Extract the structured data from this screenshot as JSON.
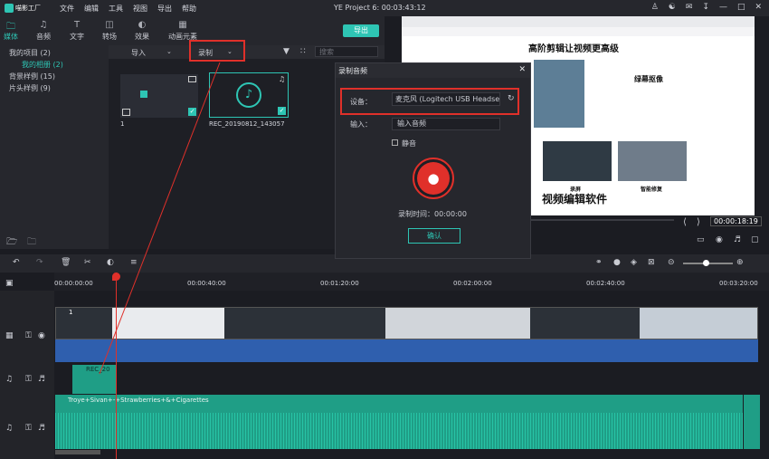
{
  "app": {
    "name": "喵影工厂",
    "window_title": "YE Project 6: 00:03:43:12"
  },
  "menu": [
    "文件",
    "编辑",
    "工具",
    "视图",
    "导出",
    "帮助"
  ],
  "tabs": [
    "媒体",
    "音频",
    "文字",
    "转场",
    "效果",
    "动画元素"
  ],
  "export_label": "导出",
  "library": {
    "items": [
      "我的项目 (2)",
      "我的相册 (2)",
      "背景样例 (15)",
      "片头样例 (9)"
    ]
  },
  "media_bar": {
    "import_label": "导入",
    "record_label": "录制",
    "search_placeholder": "搜索"
  },
  "media_items": [
    {
      "label": "1"
    },
    {
      "label": "REC_20190812_143057"
    }
  ],
  "dialog": {
    "title": "录制音频",
    "device_label": "设备：",
    "device_value": "麦克风 (Logitech USB Headse",
    "input_label": "输入：",
    "input_value": "输入音频",
    "mute_label": "静音",
    "time_label": "录制时间：00:00:00",
    "confirm_label": "确认"
  },
  "preview": {
    "heading": "高阶剪辑让视频更高级",
    "sub1": "绿幕抠像",
    "sub2": "录屏",
    "sub3": "智能修复",
    "big_text": "视频编辑软件",
    "timecode": "00:00:18:19"
  },
  "ruler": [
    "00:00:00:00",
    "00:00:40:00",
    "00:01:20:00",
    "00:02:00:00",
    "00:02:40:00",
    "00:03:20:00"
  ],
  "tracks": {
    "video_clip_label": "1",
    "record_clip_label": "REC_20",
    "music_clip_label": "Troye+Sivan+-+Strawberries+&+Cigarettes"
  },
  "colors": {
    "accent": "#2ec5b4",
    "red": "#e0302a",
    "audio_green": "#1f9e86",
    "audio_blue": "#2f6fd0"
  }
}
